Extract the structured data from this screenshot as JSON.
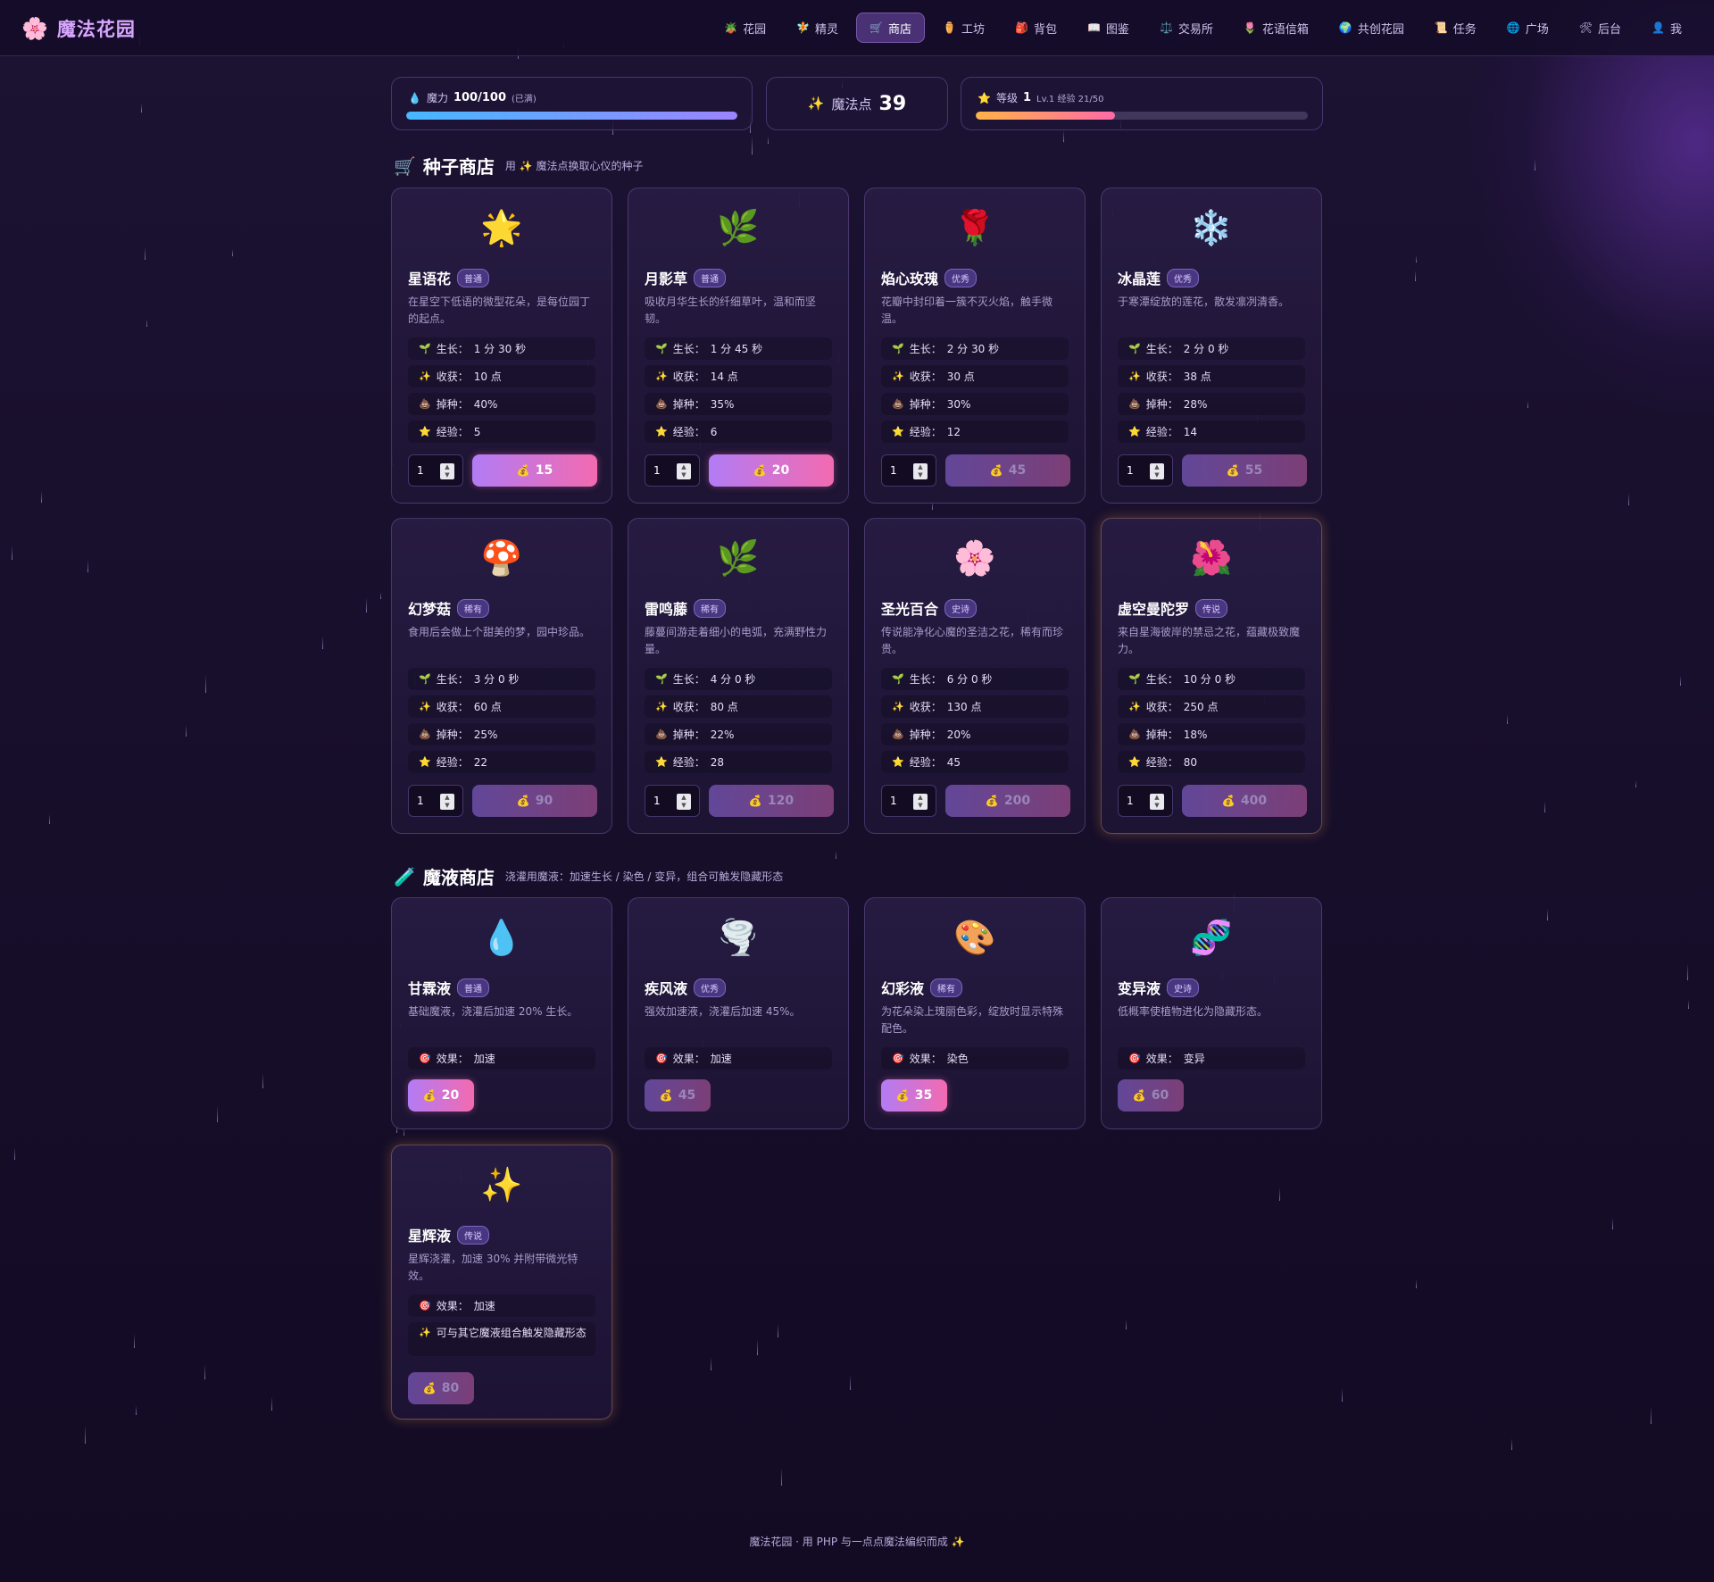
{
  "app": {
    "logo_icon": "🌸",
    "title": "魔法花园"
  },
  "nav": [
    {
      "icon": "🪴",
      "label": "花园",
      "active": false
    },
    {
      "icon": "🧚",
      "label": "精灵",
      "active": false
    },
    {
      "icon": "🛒",
      "label": "商店",
      "active": true
    },
    {
      "icon": "⚱️",
      "label": "工坊",
      "active": false
    },
    {
      "icon": "🎒",
      "label": "背包",
      "active": false
    },
    {
      "icon": "📖",
      "label": "图鉴",
      "active": false
    },
    {
      "icon": "⚖️",
      "label": "交易所",
      "active": false
    },
    {
      "icon": "🌷",
      "label": "花语信箱",
      "active": false
    },
    {
      "icon": "🌍",
      "label": "共创花园",
      "active": false
    },
    {
      "icon": "📜",
      "label": "任务",
      "active": false
    },
    {
      "icon": "🌐",
      "label": "广场",
      "active": false
    },
    {
      "icon": "🛠",
      "label": "后台",
      "active": false
    },
    {
      "icon": "👤",
      "label": "我",
      "active": false
    }
  ],
  "stats": {
    "mana": {
      "icon": "💧",
      "label": "魔力",
      "value": "100/100",
      "note": "(已满)",
      "fill": 1.0
    },
    "points": {
      "icon": "✨",
      "label": "魔法点",
      "value": "39"
    },
    "level": {
      "icon": "⭐",
      "label": "等级",
      "value": "1",
      "note": "Lv.1 经验 21/50",
      "fill": 0.42
    }
  },
  "seed_shop": {
    "icon": "🛒",
    "title": "种子商店",
    "subtitle": "用 ✨ 魔法点换取心仪的种子",
    "attr_labels": {
      "grow": "生长：",
      "harvest": "收获：",
      "drop": "掉种：",
      "exp": "经验："
    },
    "attr_icons": {
      "grow": "🌱",
      "harvest": "✨",
      "drop": "💩",
      "exp": "⭐"
    },
    "items": [
      {
        "emoji": "🌟",
        "name": "星语花",
        "rarity": "普通",
        "desc": "在星空下低语的微型花朵，是每位园丁的起点。",
        "grow": "1 分 30 秒",
        "harvest": "10 点",
        "drop": "40%",
        "exp": "5",
        "qty": "1",
        "price": "15",
        "affordable": true
      },
      {
        "emoji": "🌿",
        "name": "月影草",
        "rarity": "普通",
        "desc": "吸收月华生长的纤细草叶，温和而坚韧。",
        "grow": "1 分 45 秒",
        "harvest": "14 点",
        "drop": "35%",
        "exp": "6",
        "qty": "1",
        "price": "20",
        "affordable": true
      },
      {
        "emoji": "🌹",
        "name": "焰心玫瑰",
        "rarity": "优秀",
        "desc": "花瓣中封印着一簇不灭火焰，触手微温。",
        "grow": "2 分 30 秒",
        "harvest": "30 点",
        "drop": "30%",
        "exp": "12",
        "qty": "1",
        "price": "45",
        "affordable": false
      },
      {
        "emoji": "❄️",
        "name": "冰晶莲",
        "rarity": "优秀",
        "desc": "于寒潭绽放的莲花，散发凛冽清香。",
        "grow": "2 分 0 秒",
        "harvest": "38 点",
        "drop": "28%",
        "exp": "14",
        "qty": "1",
        "price": "55",
        "affordable": false
      },
      {
        "emoji": "🍄",
        "name": "幻梦菇",
        "rarity": "稀有",
        "desc": "食用后会做上个甜美的梦，园中珍品。",
        "grow": "3 分 0 秒",
        "harvest": "60 点",
        "drop": "25%",
        "exp": "22",
        "qty": "1",
        "price": "90",
        "affordable": false
      },
      {
        "emoji": "🌿",
        "name": "雷鸣藤",
        "rarity": "稀有",
        "desc": "藤蔓间游走着细小的电弧，充满野性力量。",
        "grow": "4 分 0 秒",
        "harvest": "80 点",
        "drop": "22%",
        "exp": "28",
        "qty": "1",
        "price": "120",
        "affordable": false
      },
      {
        "emoji": "🌸",
        "name": "圣光百合",
        "rarity": "史诗",
        "desc": "传说能净化心魔的圣洁之花，稀有而珍贵。",
        "grow": "6 分 0 秒",
        "harvest": "130 点",
        "drop": "20%",
        "exp": "45",
        "qty": "1",
        "price": "200",
        "affordable": false
      },
      {
        "emoji": "🌺",
        "name": "虚空曼陀罗",
        "rarity": "传说",
        "desc": "来自星海彼岸的禁忌之花，蕴藏极致魔力。",
        "grow": "10 分 0 秒",
        "harvest": "250 点",
        "drop": "18%",
        "exp": "80",
        "qty": "1",
        "price": "400",
        "affordable": false
      }
    ]
  },
  "potion_shop": {
    "icon": "🧪",
    "title": "魔液商店",
    "subtitle": "浇灌用魔液：加速生长 / 染色 / 变异，组合可触发隐藏形态",
    "effect_label": "效果：",
    "effect_icon": "🎯",
    "items": [
      {
        "emoji": "💧",
        "name": "甘霖液",
        "rarity": "普通",
        "desc": "基础魔液，浇灌后加速 20% 生长。",
        "effect": "加速",
        "extra": "",
        "price": "20",
        "affordable": true
      },
      {
        "emoji": "🌪️",
        "name": "疾风液",
        "rarity": "优秀",
        "desc": "强效加速液，浇灌后加速 45%。",
        "effect": "加速",
        "extra": "",
        "price": "45",
        "affordable": false
      },
      {
        "emoji": "🎨",
        "name": "幻彩液",
        "rarity": "稀有",
        "desc": "为花朵染上瑰丽色彩，绽放时显示特殊配色。",
        "effect": "染色",
        "extra": "",
        "price": "35",
        "affordable": true
      },
      {
        "emoji": "🧬",
        "name": "变异液",
        "rarity": "史诗",
        "desc": "低概率使植物进化为隐藏形态。",
        "effect": "变异",
        "extra": "",
        "price": "60",
        "affordable": false
      },
      {
        "emoji": "✨",
        "name": "星辉液",
        "rarity": "传说",
        "desc": "星辉浇灌，加速 30% 并附带微光特效。",
        "effect": "加速",
        "extra": "可与其它魔液组合触发隐藏形态",
        "price": "80",
        "affordable": false
      }
    ]
  },
  "price_icon": "💰",
  "footer": "魔法花园 · 用 PHP 与一点点魔法编织而成 ✨"
}
